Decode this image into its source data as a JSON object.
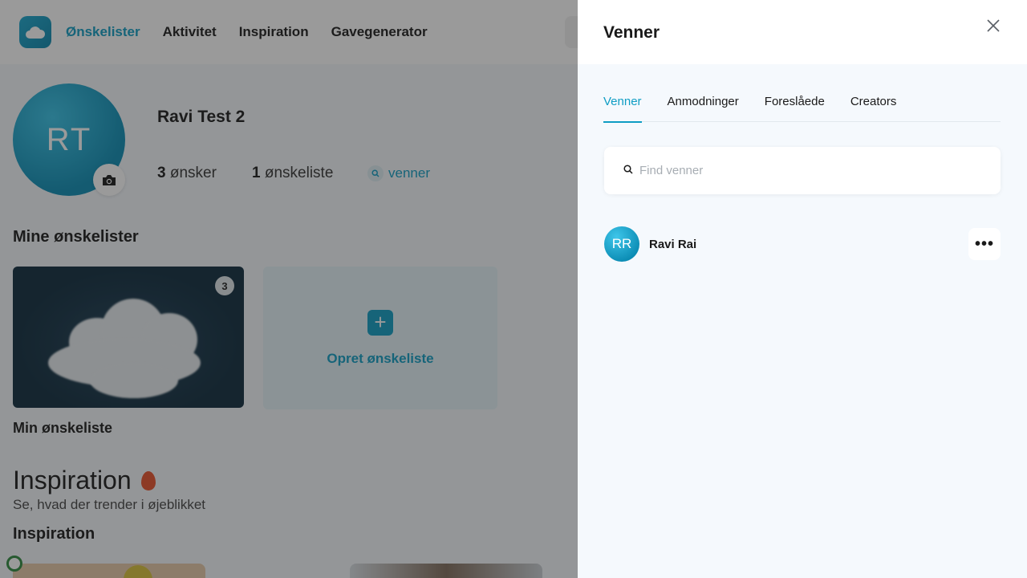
{
  "nav": {
    "items": [
      "Ønskelister",
      "Aktivitet",
      "Inspiration",
      "Gavegenerator"
    ],
    "active": "Ønskelister"
  },
  "profile": {
    "initials": "RT",
    "name": "Ravi Test 2",
    "wishes_count": "3",
    "wishes_label": "ønsker",
    "lists_count": "1",
    "lists_label": "ønskeliste",
    "friends_label": "venner"
  },
  "wishlists": {
    "section_title": "Mine ønskelister",
    "cards": [
      {
        "name": "Min ønskeliste",
        "count": "3"
      }
    ],
    "create_label": "Opret ønskeliste"
  },
  "inspiration": {
    "heading": "Inspiration",
    "subheading": "Se, hvad der trender i øjeblikket",
    "section_title": "Inspiration"
  },
  "drawer": {
    "title": "Venner",
    "tabs": [
      "Venner",
      "Anmodninger",
      "Foreslåede",
      "Creators"
    ],
    "active_tab": "Venner",
    "search_placeholder": "Find venner",
    "friends": [
      {
        "initials": "RR",
        "name": "Ravi Rai"
      }
    ],
    "more_label": "•••"
  },
  "colors": {
    "accent": "#0f9dc4",
    "overlay": "rgba(30,30,30,0.45)",
    "drawer_bg": "#f5f9fd"
  },
  "icons": [
    "cloud-logo-icon",
    "camera-icon",
    "search-icon",
    "close-icon",
    "plus-icon",
    "flame-icon",
    "more-icon",
    "help-icon"
  ]
}
